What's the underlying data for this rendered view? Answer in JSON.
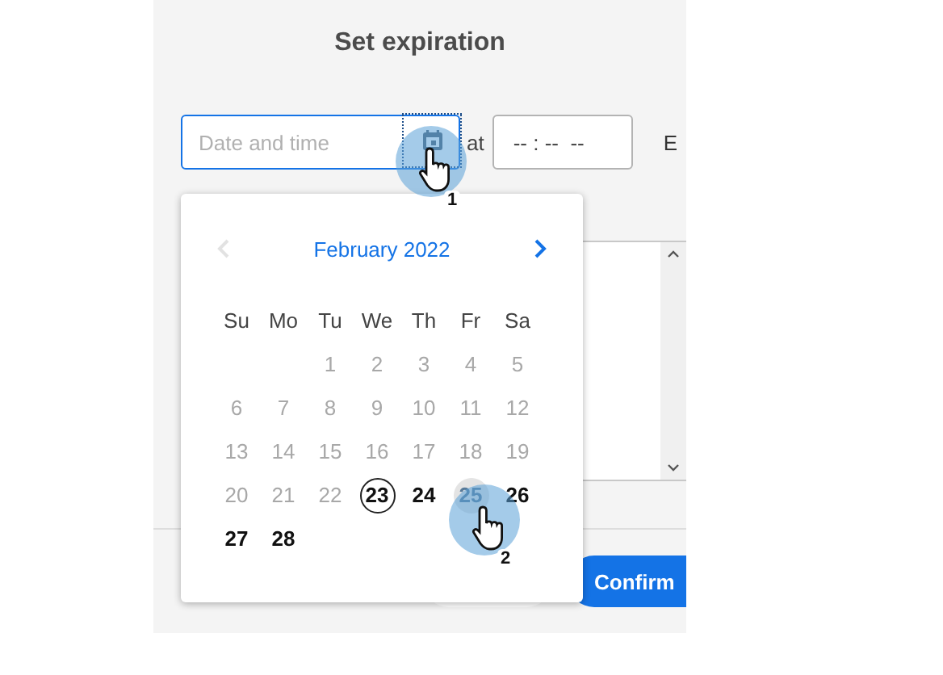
{
  "dialog": {
    "title": "Set expiration",
    "date_field": {
      "placeholder": "Date and time",
      "focused": true
    },
    "at_label": "at",
    "time_field": {
      "placeholder": "-- : --  --"
    },
    "cut_label": "E",
    "confirm_button": "Confirm"
  },
  "calendar": {
    "month": "February 2022",
    "prev_disabled": true,
    "weekdays": [
      "Su",
      "Mo",
      "Tu",
      "We",
      "Th",
      "Fr",
      "Sa"
    ],
    "weeks": [
      [
        {
          "day": "1",
          "disabled": true,
          "today": false,
          "hovered": false
        },
        {
          "day": "2",
          "disabled": true,
          "today": false,
          "hovered": false
        },
        {
          "day": "3",
          "disabled": true,
          "today": false,
          "hovered": false
        },
        {
          "day": "4",
          "disabled": true,
          "today": false,
          "hovered": false
        },
        {
          "day": "5",
          "disabled": true,
          "today": false,
          "hovered": false
        }
      ],
      [
        {
          "day": "6",
          "disabled": true,
          "today": false,
          "hovered": false
        },
        {
          "day": "7",
          "disabled": true,
          "today": false,
          "hovered": false
        },
        {
          "day": "8",
          "disabled": true,
          "today": false,
          "hovered": false
        },
        {
          "day": "9",
          "disabled": true,
          "today": false,
          "hovered": false
        },
        {
          "day": "10",
          "disabled": true,
          "today": false,
          "hovered": false
        },
        {
          "day": "11",
          "disabled": true,
          "today": false,
          "hovered": false
        },
        {
          "day": "12",
          "disabled": true,
          "today": false,
          "hovered": false
        }
      ],
      [
        {
          "day": "13",
          "disabled": true,
          "today": false,
          "hovered": false
        },
        {
          "day": "14",
          "disabled": true,
          "today": false,
          "hovered": false
        },
        {
          "day": "15",
          "disabled": true,
          "today": false,
          "hovered": false
        },
        {
          "day": "16",
          "disabled": true,
          "today": false,
          "hovered": false
        },
        {
          "day": "17",
          "disabled": true,
          "today": false,
          "hovered": false
        },
        {
          "day": "18",
          "disabled": true,
          "today": false,
          "hovered": false
        },
        {
          "day": "19",
          "disabled": true,
          "today": false,
          "hovered": false
        }
      ],
      [
        {
          "day": "20",
          "disabled": true,
          "today": false,
          "hovered": false
        },
        {
          "day": "21",
          "disabled": true,
          "today": false,
          "hovered": false
        },
        {
          "day": "22",
          "disabled": true,
          "today": false,
          "hovered": false
        },
        {
          "day": "23",
          "disabled": false,
          "today": true,
          "hovered": false
        },
        {
          "day": "24",
          "disabled": false,
          "today": false,
          "hovered": false
        },
        {
          "day": "25",
          "disabled": false,
          "today": false,
          "hovered": true
        },
        {
          "day": "26",
          "disabled": false,
          "today": false,
          "hovered": false
        }
      ],
      [
        {
          "day": "27",
          "disabled": false,
          "today": false,
          "hovered": false
        },
        {
          "day": "28",
          "disabled": false,
          "today": false,
          "hovered": false
        }
      ]
    ]
  },
  "click_markers": [
    {
      "number": "1"
    },
    {
      "number": "2"
    }
  ]
}
